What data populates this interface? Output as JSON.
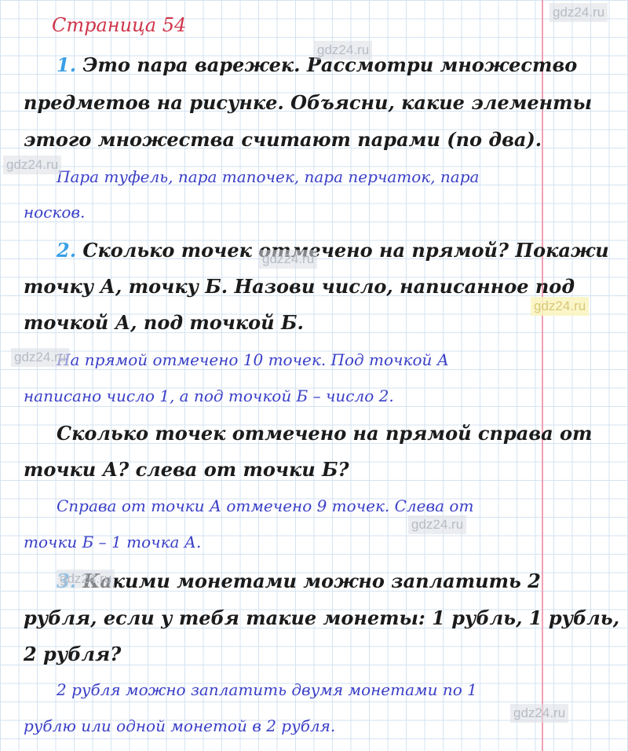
{
  "page_title": "Страница 54",
  "exercises": [
    {
      "number": "1.",
      "question_lines": [
        "Это пара варежек. Рассмотри множество",
        "предметов на рисунке. Объясни, какие элементы",
        "этого множества считают парами (по два)."
      ],
      "answer_lines": [
        "Пара туфель, пара тапочек, пара перчаток, пара",
        "носков."
      ]
    },
    {
      "number": "2.",
      "question_lines": [
        "Сколько точек отмечено на прямой? Покажи",
        "точку А, точку Б. Назови число, написанное под",
        "точкой А, под точкой Б."
      ],
      "answer_lines": [
        "На прямой отмечено 10 точек. Под точкой А",
        "написано число 1, а под точкой Б – число 2."
      ],
      "question2_lines": [
        "Сколько точек отмечено на прямой справа от",
        "точки А? слева от точки Б?"
      ],
      "answer2_lines": [
        "Справа от точки А отмечено 9 точек. Слева от",
        "точки Б – 1 точка А."
      ]
    },
    {
      "number": "3.",
      "question_lines": [
        "Какими монетами можно заплатить 2",
        "рубля, если у тебя такие монеты: 1 рубль, 1 рубль,",
        "2 рубля?"
      ],
      "answer_lines": [
        "2 рубля можно заплатить двумя монетами по 1",
        "рублю или одной монетой в 2 рубля."
      ]
    }
  ],
  "watermark": "gdz24.ru"
}
